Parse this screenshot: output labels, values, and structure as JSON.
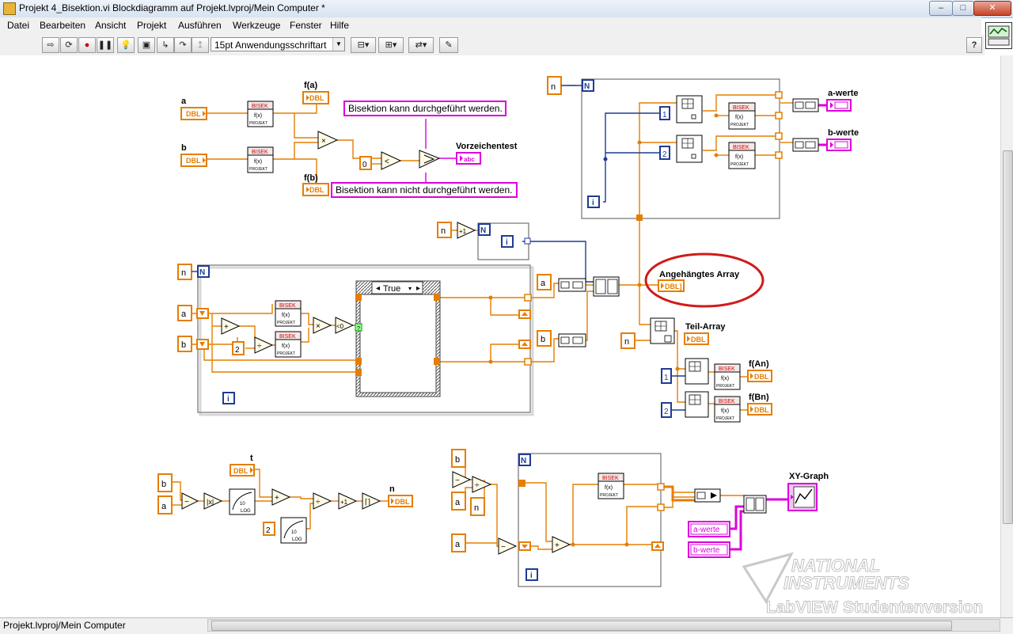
{
  "window": {
    "title": "Projekt 4_Bisektion.vi Blockdiagramm auf Projekt.lvproj/Mein Computer *",
    "controls": [
      "–",
      "□",
      "✕"
    ]
  },
  "menu": [
    "Datei",
    "Bearbeiten",
    "Ansicht",
    "Projekt",
    "Ausführen",
    "Werkzeuge",
    "Fenster",
    "Hilfe"
  ],
  "toolbar": {
    "font": "15pt Anwendungsschriftart",
    "help": "?"
  },
  "status": {
    "project": "Projekt.lvproj/Mein Computer"
  },
  "colors": {
    "numeric": "#e57e00",
    "string": "#dd00dd",
    "integer": "#1f3c94",
    "annotation": "#d11a1a"
  },
  "diagram": {
    "section_top": {
      "ctrl_a": "a",
      "ctrl_b": "b",
      "dbl_tag": "DBL",
      "bisek": "BISEK",
      "fx": "f(x)",
      "projekt": "PROJEKT",
      "ind_fa": "f(a)",
      "ind_fb": "f(b)",
      "const_zero": "0",
      "msg_ok": "Bisektion kann durchgeführt werden.",
      "msg_no": "Bisektion kann nicht durchgeführt werden.",
      "ind_vorzeichen": "Vorzeichentest",
      "abc_tag": "abc"
    },
    "section_loop": {
      "n": "n",
      "loop_N": "N",
      "loop_i": "i",
      "a": "a",
      "b": "b",
      "const_2": "2",
      "case_label": "True",
      "cmp_lt0": "<0",
      "plus1": "+1"
    },
    "section_arrays": {
      "n": "n",
      "loop_N": "N",
      "loop_i": "i",
      "const_1": "1",
      "const_2": "2",
      "ind_awerte": "a-werte",
      "ind_bwerte": "b-werte",
      "angehaengt": "Angehängtes Array",
      "angehaengt_tag": "DBL]",
      "teilarray": "Teil-Array",
      "f_an": "f(An)",
      "f_bn": "f(Bn)"
    },
    "section_iter": {
      "b": "b",
      "a": "a",
      "t": "t",
      "n_ind": "n",
      "const_2": "2",
      "log": "LOG",
      "ten": "10"
    },
    "section_graph": {
      "b": "b",
      "a": "a",
      "n": "n",
      "loop_N": "N",
      "loop_i": "i",
      "graph": "XY-Graph",
      "lbl_awerte": "a-werte",
      "lbl_bwerte": "b-werte"
    },
    "watermark": {
      "brand1": "NATIONAL",
      "brand2": "INSTRUMENTS",
      "edition": "LabVIEW Studentenversion"
    }
  }
}
